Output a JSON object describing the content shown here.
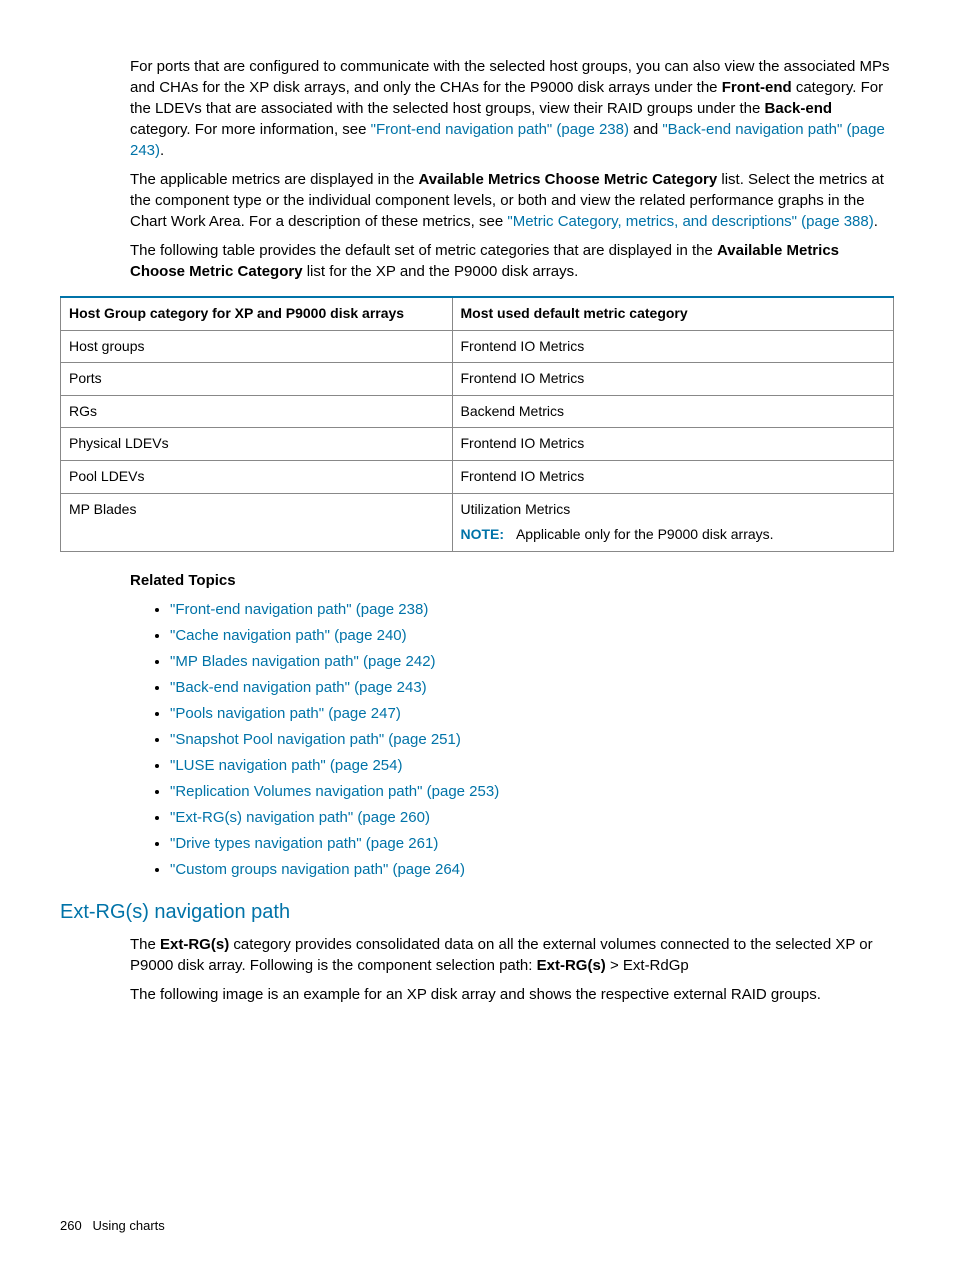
{
  "para1": {
    "t1": "For ports that are configured to communicate with the selected host groups, you can also view the associated MPs and CHAs for the XP disk arrays, and only the CHAs for the P9000 disk arrays under the ",
    "b1": "Front-end",
    "t2": " category. For the LDEVs that are associated with the selected host groups, view their RAID groups under the ",
    "b2": "Back-end",
    "t3": " category. For more information, see ",
    "l1": "\"Front-end navigation path\" (page 238)",
    "t4": " and ",
    "l2": "\"Back-end navigation path\" (page 243)",
    "t5": "."
  },
  "para2": {
    "t1": "The applicable metrics are displayed in the ",
    "b1": "Available Metrics Choose Metric Category",
    "t2": " list. Select the metrics at the component type or the individual component levels, or both and view the related performance graphs in the Chart Work Area. For a description of these metrics, see ",
    "l1": "\"Metric Category, metrics, and descriptions\" (page 388)",
    "t3": "."
  },
  "para3": {
    "t1": "The following table provides the default set of metric categories that are displayed in the ",
    "b1": "Available Metrics Choose Metric Category",
    "t2": " list for the XP and the P9000 disk arrays."
  },
  "table": {
    "h1": "Host Group category for XP and P9000 disk arrays",
    "h2": "Most used default metric category",
    "rows": [
      {
        "c1": "Host groups",
        "c2": "Frontend IO Metrics"
      },
      {
        "c1": "Ports",
        "c2": "Frontend IO Metrics"
      },
      {
        "c1": "RGs",
        "c2": "Backend Metrics"
      },
      {
        "c1": "Physical LDEVs",
        "c2": "Frontend IO Metrics"
      },
      {
        "c1": "Pool LDEVs",
        "c2": "Frontend IO Metrics"
      }
    ],
    "last": {
      "c1": "MP Blades",
      "c2a": "Utilization Metrics",
      "noteLabel": "NOTE:",
      "noteText": "Applicable only for the P9000 disk arrays."
    }
  },
  "related": {
    "heading": "Related Topics",
    "items": [
      "\"Front-end navigation path\" (page 238)",
      "\"Cache navigation path\" (page 240)",
      "\"MP Blades navigation path\" (page 242)",
      "\"Back-end navigation path\" (page 243)",
      "\"Pools navigation path\" (page 247)",
      "\"Snapshot Pool navigation path\" (page 251)",
      "\"LUSE navigation path\" (page 254)",
      "\"Replication Volumes navigation path\" (page 253)",
      "\"Ext-RG(s) navigation path\" (page 260)",
      "\"Drive types navigation path\" (page 261)",
      "\"Custom groups navigation path\" (page 264)"
    ]
  },
  "section": {
    "title": "Ext-RG(s) navigation path",
    "p1": {
      "t1": "The ",
      "b1": "Ext-RG(s)",
      "t2": " category provides consolidated data on all the external volumes connected to the selected XP or P9000 disk array. Following is the component selection path: ",
      "b2": "Ext-RG(s)",
      "t3": " > Ext-RdGp"
    },
    "p2": "The following image is an example for an XP disk array and shows the respective external RAID groups."
  },
  "footer": {
    "page": "260",
    "label": "Using charts"
  }
}
